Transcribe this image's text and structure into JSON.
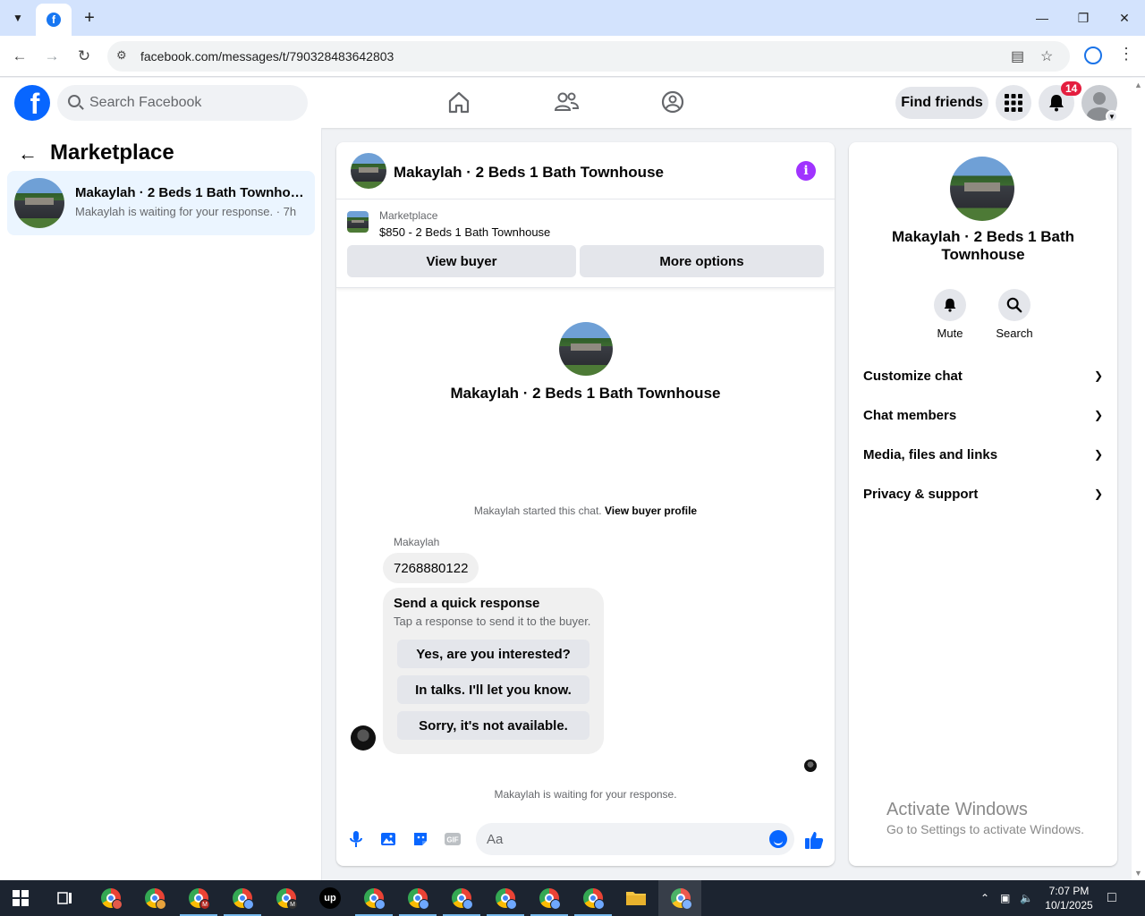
{
  "browser": {
    "url": "facebook.com/messages/t/790328483642803",
    "tab_favicon_letter": "f"
  },
  "fb": {
    "search_placeholder": "Search Facebook",
    "find_friends": "Find friends",
    "notification_count": "14"
  },
  "left": {
    "title": "Marketplace",
    "conversation": {
      "title": "Makaylah · 2 Beds 1 Bath Townhouse",
      "subtitle": "Makaylah is waiting for your response. · 7h"
    }
  },
  "chat": {
    "header_title": "Makaylah · 2 Beds 1 Bath Townhouse",
    "listing_label": "Marketplace",
    "listing_price": "$850 - 2 Beds 1 Bath Townhouse",
    "view_buyer": "View buyer",
    "more_options": "More options",
    "center_name": "Makaylah · 2 Beds 1 Bath Townhouse",
    "started_text": "Makaylah started this chat.",
    "view_buyer_profile": "View buyer profile",
    "sender_name": "Makaylah",
    "message": "7268880122",
    "quick_title": "Send a quick response",
    "quick_sub": "Tap a response to send it to the buyer.",
    "quick_responses": [
      "Yes, are you interested?",
      "In talks. I'll let you know.",
      "Sorry, it's not available."
    ],
    "waiting_text": "Makaylah is waiting for your response.",
    "composer_placeholder": "Aa"
  },
  "right": {
    "name": "Makaylah · 2 Beds 1 Bath Townhouse",
    "mute": "Mute",
    "search": "Search",
    "sections": [
      "Customize chat",
      "Chat members",
      "Media, files and links",
      "Privacy & support"
    ]
  },
  "watermark": {
    "line1": "Activate Windows",
    "line2": "Go to Settings to activate Windows."
  },
  "taskbar": {
    "time": "7:07 PM",
    "date": "10/1/2025"
  },
  "colors": {
    "fb_blue": "#0866ff",
    "selected_conv_bg": "#ebf5ff",
    "badge_red": "#e41e3f",
    "info_purple": "#a033ff"
  }
}
